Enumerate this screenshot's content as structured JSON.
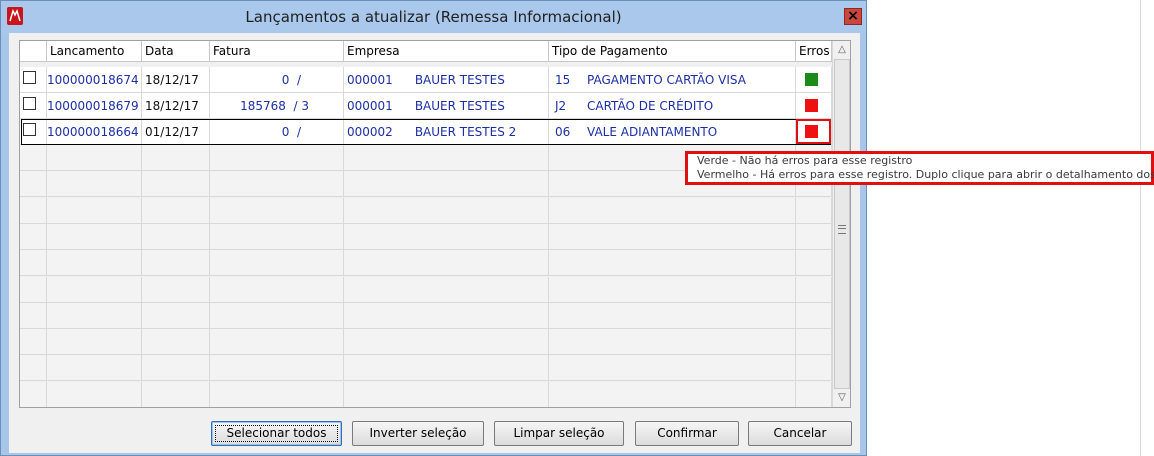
{
  "window": {
    "title": "Lançamentos a atualizar (Remessa Informacional)",
    "close_label": "×"
  },
  "grid": {
    "headers": {
      "lancamento": "Lancamento",
      "data": "Data",
      "fatura": "Fatura",
      "empresa": "Empresa",
      "tipo_pagamento": "Tipo de Pagamento",
      "erros": "Erros"
    },
    "rows": [
      {
        "lancamento": "100000018674",
        "data": "18/12/17",
        "fatura": "0  /",
        "empresa_codigo": "000001",
        "empresa_nome": "BAUER TESTES",
        "tipo_codigo": "15",
        "tipo_nome": "PAGAMENTO CARTÃO VISA",
        "erro_color": "#1a8a1a",
        "checked": false
      },
      {
        "lancamento": "100000018679",
        "data": "18/12/17",
        "fatura": "185768  / 3",
        "empresa_codigo": "000001",
        "empresa_nome": "BAUER TESTES",
        "tipo_codigo": "J2",
        "tipo_nome": "CARTÃO DE CRÉDITO",
        "erro_color": "#ee1111",
        "checked": false
      },
      {
        "lancamento": "100000018664",
        "data": "01/12/17",
        "fatura": "0  /",
        "empresa_codigo": "000002",
        "empresa_nome": "BAUER TESTES 2",
        "tipo_codigo": "06",
        "tipo_nome": "VALE ADIANTAMENTO",
        "erro_color": "#ee1111",
        "checked": false
      }
    ]
  },
  "tooltip": {
    "line1": "Verde - Não há erros para esse registro",
    "line2": "Vermelho - Há erros para esse registro. Duplo clique para abrir o detalhamento dos erros"
  },
  "buttons": {
    "selecionar_todos": "Selecionar todos",
    "inverter_selecao": "Inverter seleção",
    "limpar_selecao": "Limpar seleção",
    "confirmar": "Confirmar",
    "cancelar": "Cancelar"
  },
  "colors": {
    "title_bar": "#a9c8ec",
    "ok": "#1a8a1a",
    "error": "#ee1111",
    "highlight": "#e01010",
    "data_text": "#1c2fa6"
  }
}
